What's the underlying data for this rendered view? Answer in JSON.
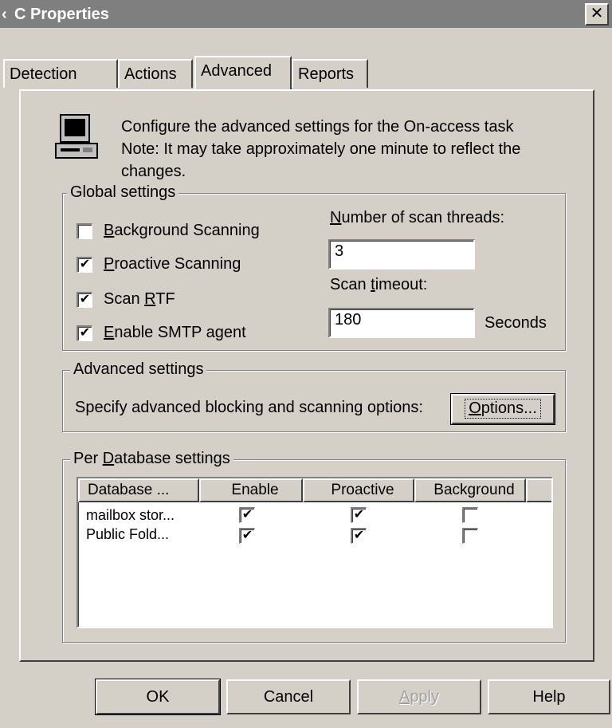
{
  "window": {
    "title": "C Properties",
    "title_prefix_glyph": "‹"
  },
  "tabs": [
    {
      "label": "Detection",
      "active": false
    },
    {
      "label": "Actions",
      "active": false
    },
    {
      "label": "Advanced",
      "active": true
    },
    {
      "label": "Reports",
      "active": false
    }
  ],
  "intro": {
    "line1": "Configure the advanced settings for the On-access task",
    "line2": "Note: It may take approximately one minute to reflect the",
    "line3": "changes."
  },
  "global_settings": {
    "title": "Global settings",
    "background_scanning": {
      "label_pre": "",
      "label_accel": "B",
      "label_post": "ackground Scanning",
      "checked": false
    },
    "proactive_scanning": {
      "label_pre": "",
      "label_accel": "P",
      "label_post": "roactive Scanning",
      "checked": true
    },
    "scan_rtf": {
      "label_pre": "Scan ",
      "label_accel": "R",
      "label_post": "TF",
      "checked": true
    },
    "enable_smtp": {
      "label_pre": "",
      "label_accel": "E",
      "label_post": "nable SMTP agent",
      "checked": true
    },
    "threads_label_accel": "N",
    "threads_label_post": "umber of scan threads:",
    "threads_value": "3",
    "timeout_label_pre": "Scan ",
    "timeout_label_accel": "t",
    "timeout_label_post": "imeout:",
    "timeout_value": "180",
    "timeout_unit": "Seconds"
  },
  "advanced_settings": {
    "title": "Advanced settings",
    "description": "Specify advanced blocking and scanning options:",
    "options_button_accel": "O",
    "options_button_post": "ptions..."
  },
  "per_database": {
    "title_pre": "Per ",
    "title_accel": "D",
    "title_post": "atabase settings",
    "columns": [
      "Database ...",
      "Enable",
      "Proactive",
      "Background"
    ],
    "rows": [
      {
        "name": "mailbox stor...",
        "enable": true,
        "proactive": true,
        "background": false
      },
      {
        "name": "Public Fold...",
        "enable": true,
        "proactive": true,
        "background": false
      }
    ]
  },
  "footer": {
    "ok": "OK",
    "cancel": "Cancel",
    "apply_accel": "A",
    "apply_post": "pply",
    "help": "Help"
  },
  "icons": {
    "monitor": "computer-monitor-icon",
    "check": "✔"
  }
}
